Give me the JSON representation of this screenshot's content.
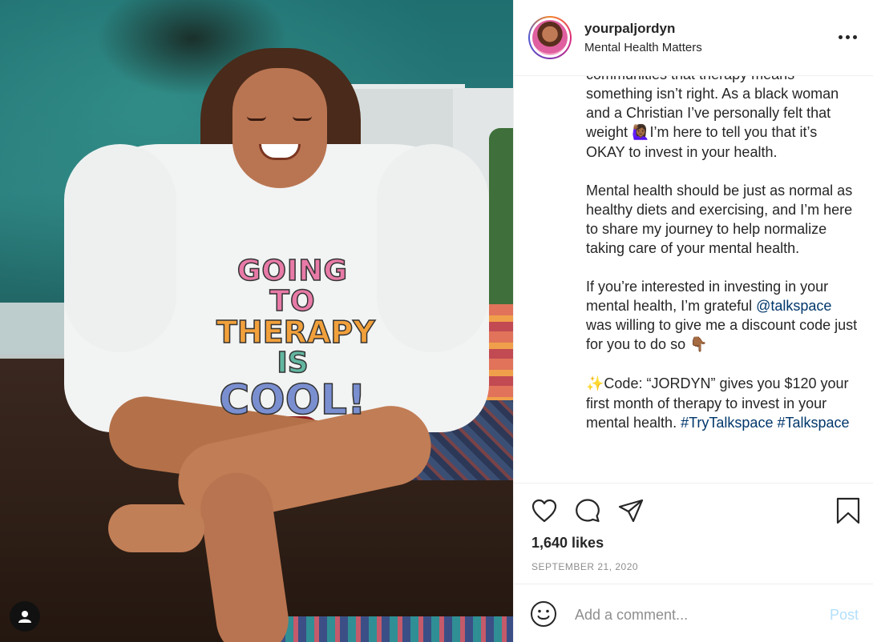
{
  "post": {
    "username": "yourpaljordyn",
    "subtitle": "Mental Health Matters",
    "more_label": "More options"
  },
  "photo": {
    "shirt_lines": [
      "GOING TO",
      "THERAPY",
      "IS",
      "COOL!"
    ]
  },
  "caption": {
    "p1_a": "communities that therapy means something isn’t right. As a black woman and a Christian I’ve personally felt that weight ",
    "p1_emoji": "🙋🏾‍♀️",
    "p1_b": "I’m here to tell you that it’s OKAY to invest in your health.",
    "p2": "Mental health should be just as normal as healthy diets and exercising, and I’m here to share my journey to help normalize taking care of your mental health.",
    "p3_a": "If you’re interested in investing in your mental health, I’m grateful ",
    "p3_link": "@talkspace",
    "p3_b": " was willing to give me a discount code just for you to do so ",
    "p3_emoji": "👇🏾",
    "p4_emoji": "✨",
    "p4_a": "Code: “JORDYN” gives you $120 your first month of therapy to invest in your mental health. ",
    "p4_tag1": "#TryTalkspace",
    "p4_tag2": "#Talkspace"
  },
  "stats": {
    "likes": "1,640 likes",
    "date": "SEPTEMBER 21, 2020"
  },
  "comment": {
    "placeholder": "Add a comment...",
    "post_label": "Post"
  },
  "colors": {
    "link": "#00376b",
    "post_disabled": "#b2dffc",
    "muted": "#8e8e8e"
  }
}
